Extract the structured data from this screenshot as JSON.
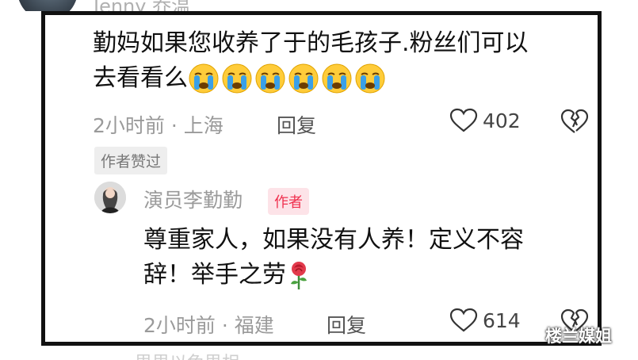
{
  "header": {
    "username_partial": "Jenny 乔温"
  },
  "comment": {
    "line1": "勤妈如果您收养了于的毛孩子.粉丝们可以",
    "line2": "去看看么",
    "emoji_count": 6,
    "time": "2小时前",
    "location": "上海",
    "reply_label": "回复",
    "like_count": "402",
    "author_liked_tag": "作者赞过"
  },
  "author_reply": {
    "name": "演员李勤勤",
    "badge": "作者",
    "line1": "尊重家人，如果没有人养！定义不容",
    "line2": "辞！举手之劳",
    "time": "2小时前",
    "location": "福建",
    "reply_label": "回复",
    "like_count": "614"
  },
  "watermark": "楼兰媒姐",
  "bottom_partial": "思思以免思相",
  "colors": {
    "frame": "#111111",
    "badge_red": "#f0304e",
    "emoji_blue": "#3aa0e8",
    "emoji_face": "#ffcc3a"
  }
}
